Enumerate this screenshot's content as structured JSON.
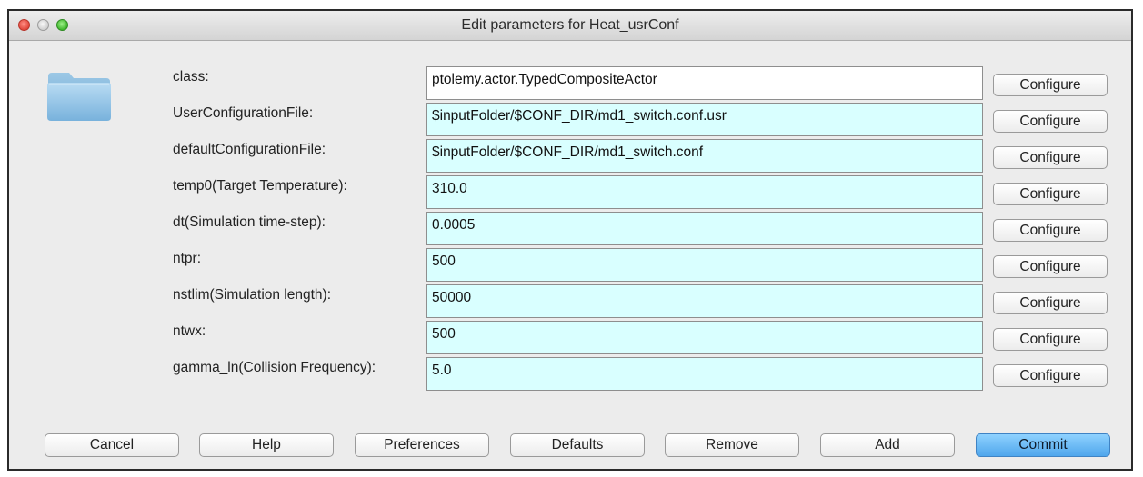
{
  "window": {
    "title": "Edit parameters for Heat_usrConf"
  },
  "params": [
    {
      "label": "class:",
      "value": "ptolemy.actor.TypedCompositeActor",
      "configure": "Configure"
    },
    {
      "label": "UserConfigurationFile:",
      "value": "$inputFolder/$CONF_DIR/md1_switch.conf.usr",
      "configure": "Configure"
    },
    {
      "label": "defaultConfigurationFile:",
      "value": "$inputFolder/$CONF_DIR/md1_switch.conf",
      "configure": "Configure"
    },
    {
      "label": "temp0(Target Temperature):",
      "value": "310.0",
      "configure": "Configure"
    },
    {
      "label": "dt(Simulation time-step):",
      "value": "0.0005",
      "configure": "Configure"
    },
    {
      "label": "ntpr:",
      "value": "500",
      "configure": "Configure"
    },
    {
      "label": "nstlim(Simulation length):",
      "value": "50000",
      "configure": "Configure"
    },
    {
      "label": "ntwx:",
      "value": "500",
      "configure": "Configure"
    },
    {
      "label": "gamma_ln(Collision Frequency):",
      "value": "5.0",
      "configure": "Configure"
    }
  ],
  "buttons": {
    "cancel": "Cancel",
    "help": "Help",
    "preferences": "Preferences",
    "defaults": "Defaults",
    "remove": "Remove",
    "add": "Add",
    "commit": "Commit"
  },
  "colors": {
    "field_bg": "#d9ffff",
    "class_field_bg": "#ffffff",
    "commit_accent": "#4fa6ec",
    "close_button": "#e0463a",
    "maximize_button": "#3fb62c"
  },
  "icons": {
    "close": "close-traffic-light",
    "minimize": "minimize-traffic-light",
    "maximize": "zoom-traffic-light",
    "folder": "folder-icon"
  }
}
